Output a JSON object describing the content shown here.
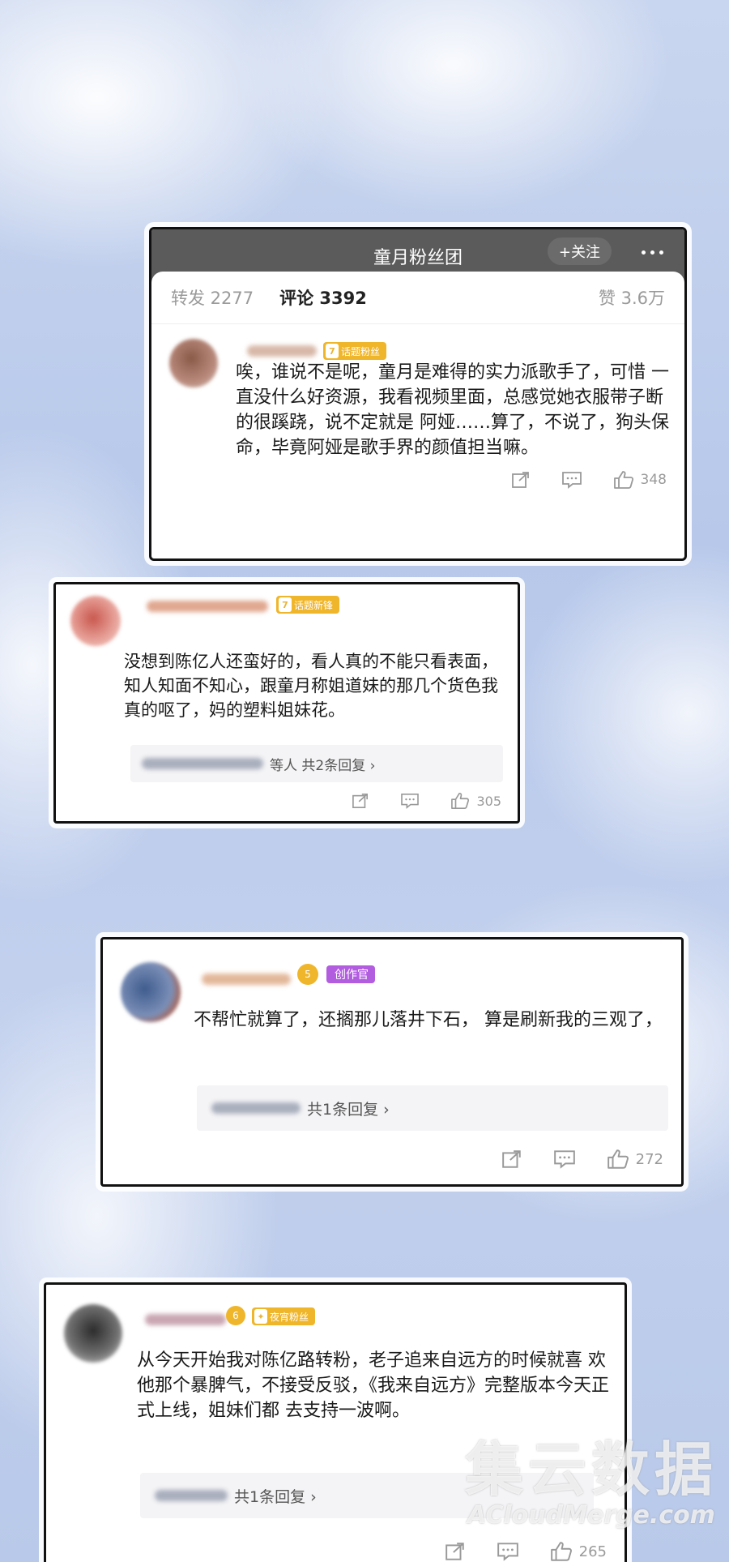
{
  "header": {
    "title": "童月粉丝团",
    "follow_label": "+关注",
    "tabs": {
      "repost": "转发 2277",
      "comments": "评论 3392",
      "likes": "赞 3.6万"
    }
  },
  "comments": [
    {
      "badge": "话题粉丝",
      "badge_level": "7",
      "text": "唉，谁说不是呢，童月是难得的实力派歌手了，可惜 一直没什么好资源，我看视频里面，总感觉她衣服带子断的很蹊跷，说不定就是 阿娅……算了，不说了，狗头保命，毕竟阿娅是歌手界的颜值担当嘛。",
      "likes": "348"
    },
    {
      "badge": "话题新锋",
      "badge_level": "7",
      "text": "没想到陈亿人还蛮好的，看人真的不能只看表面，知人知面不知心，跟童月称姐道妹的那几个货色我真的呕了，妈的塑料姐妹花。",
      "replies": "等人  共2条回复 ›",
      "likes": "305"
    },
    {
      "badge": "创作官",
      "badge_level": "5",
      "text": "不帮忙就算了，还搁那儿落井下石， 算是刷新我的三观了，",
      "replies": "共1条回复 ›",
      "likes": "272"
    },
    {
      "badge": "夜宵粉丝",
      "badge_level": "6",
      "text": "从今天开始我对陈亿路转粉，老子追来自远方的时候就喜 欢他那个暴脾气，不接受反驳，《我来自远方》完整版本今天正式上线，姐妹们都 去支持一波啊。",
      "replies": "共1条回复 ›",
      "likes": "265"
    }
  ],
  "watermark": {
    "cn": "集云数据",
    "en": "ACloudMerge.com"
  },
  "colors": {
    "accent_gold": "#f0b62b",
    "creator_purple": "#b25ce0",
    "topbar": "#5b5b5b"
  }
}
